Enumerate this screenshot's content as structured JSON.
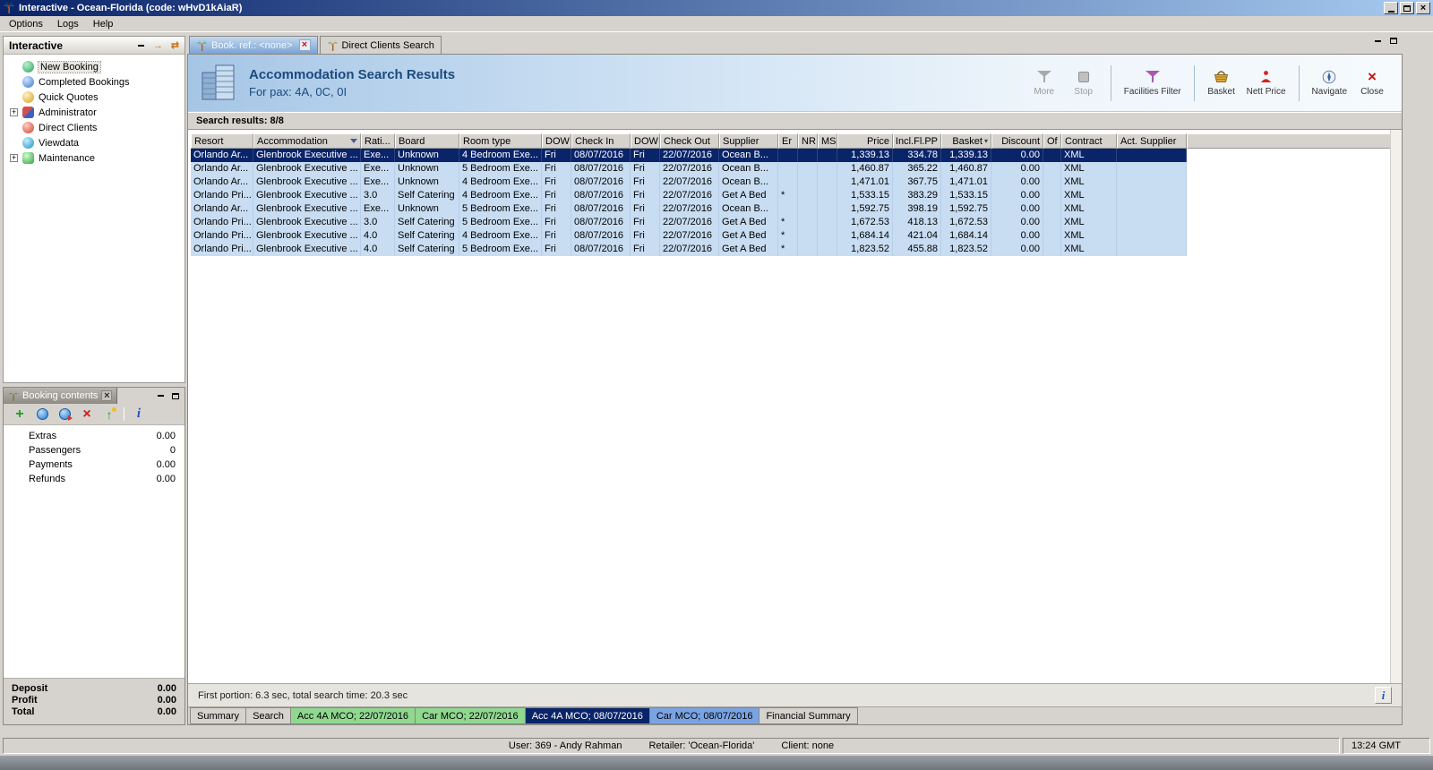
{
  "titlebar": {
    "title": "Interactive - Ocean-Florida (code: wHvD1kAiaR)"
  },
  "menu": {
    "items": [
      "Options",
      "Logs",
      "Help"
    ]
  },
  "sidebar": {
    "title": "Interactive",
    "tree": [
      {
        "label": "New Booking",
        "icon": "new-booking-icon",
        "selected": true
      },
      {
        "label": "Completed Bookings",
        "icon": "completed-bookings-icon"
      },
      {
        "label": "Quick Quotes",
        "icon": "quick-quotes-icon"
      },
      {
        "label": "Administrator",
        "icon": "administrator-icon",
        "expandable": true
      },
      {
        "label": "Direct Clients",
        "icon": "direct-clients-icon"
      },
      {
        "label": "Viewdata",
        "icon": "viewdata-icon"
      },
      {
        "label": "Maintenance",
        "icon": "maintenance-icon",
        "expandable": true
      }
    ]
  },
  "booking_contents": {
    "title": "Booking contents",
    "toolbar_icons": [
      "add-icon",
      "globe-icon",
      "export-globe-icon",
      "delete-icon",
      "promote-icon",
      "separator",
      "info-icon"
    ],
    "rows": [
      [
        "Extras",
        "0.00"
      ],
      [
        "Passengers",
        "0"
      ],
      [
        "Payments",
        "0.00"
      ],
      [
        "Refunds",
        "0.00"
      ]
    ],
    "totals": [
      [
        "Deposit",
        "0.00"
      ],
      [
        "Profit",
        "0.00"
      ],
      [
        "Total",
        "0.00"
      ]
    ]
  },
  "workspace": {
    "tabs": [
      {
        "label": "Book. ref.: <none>",
        "active": true,
        "closable": true
      },
      {
        "label": "Direct Clients Search",
        "active": false
      }
    ],
    "header": {
      "title": "Accommodation Search Results",
      "subtitle": "For pax: 4A, 0C, 0I"
    },
    "toolbar": [
      {
        "label": "More",
        "icon": "more-icon",
        "disabled": true
      },
      {
        "label": "Stop",
        "icon": "stop-icon",
        "disabled": true,
        "sep_after": true
      },
      {
        "label": "Facilities Filter",
        "icon": "facilities-filter-icon",
        "sep_after": true
      },
      {
        "label": "Basket",
        "icon": "basket-icon"
      },
      {
        "label": "Nett Price",
        "icon": "nett-price-icon",
        "sep_after": true
      },
      {
        "label": "Navigate",
        "icon": "navigate-icon"
      },
      {
        "label": "Close",
        "icon": "close-icon"
      }
    ],
    "results_label": "Search results: 8/8",
    "results_table": {
      "columns": [
        {
          "label": "Resort"
        },
        {
          "label": "Accommodation",
          "icon": "filter"
        },
        {
          "label": "Rati..."
        },
        {
          "label": "Board"
        },
        {
          "label": "Room type"
        },
        {
          "label": "DOW"
        },
        {
          "label": "Check In"
        },
        {
          "label": "DOW"
        },
        {
          "label": "Check Out"
        },
        {
          "label": "Supplier"
        },
        {
          "label": "Er"
        },
        {
          "label": "NR"
        },
        {
          "label": "MS"
        },
        {
          "label": "Price",
          "align": "right"
        },
        {
          "label": "Incl.Fl.PP",
          "align": "right"
        },
        {
          "label": "Basket",
          "align": "right",
          "icon": "sort"
        },
        {
          "label": "Discount",
          "align": "right"
        },
        {
          "label": "Of"
        },
        {
          "label": "Contract"
        },
        {
          "label": "Act. Supplier"
        }
      ],
      "selected_row": 0,
      "rows": [
        [
          "Orlando Ar...",
          "Glenbrook Executive ...",
          "Exe...",
          "Unknown",
          "4 Bedroom Exe...",
          "Fri",
          "08/07/2016",
          "Fri",
          "22/07/2016",
          "Ocean B...",
          "",
          "",
          "",
          "1,339.13",
          "334.78",
          "1,339.13",
          "0.00",
          "",
          "XML",
          ""
        ],
        [
          "Orlando Ar...",
          "Glenbrook Executive ...",
          "Exe...",
          "Unknown",
          "5 Bedroom Exe...",
          "Fri",
          "08/07/2016",
          "Fri",
          "22/07/2016",
          "Ocean B...",
          "",
          "",
          "",
          "1,460.87",
          "365.22",
          "1,460.87",
          "0.00",
          "",
          "XML",
          ""
        ],
        [
          "Orlando Ar...",
          "Glenbrook Executive ...",
          "Exe...",
          "Unknown",
          "4 Bedroom Exe...",
          "Fri",
          "08/07/2016",
          "Fri",
          "22/07/2016",
          "Ocean B...",
          "",
          "",
          "",
          "1,471.01",
          "367.75",
          "1,471.01",
          "0.00",
          "",
          "XML",
          ""
        ],
        [
          "Orlando Pri...",
          "Glenbrook Executive ...",
          "3.0",
          "Self Catering",
          "4 Bedroom Exe...",
          "Fri",
          "08/07/2016",
          "Fri",
          "22/07/2016",
          "Get A Bed",
          "*",
          "",
          "",
          "1,533.15",
          "383.29",
          "1,533.15",
          "0.00",
          "",
          "XML",
          ""
        ],
        [
          "Orlando Ar...",
          "Glenbrook Executive ...",
          "Exe...",
          "Unknown",
          "5 Bedroom Exe...",
          "Fri",
          "08/07/2016",
          "Fri",
          "22/07/2016",
          "Ocean B...",
          "",
          "",
          "",
          "1,592.75",
          "398.19",
          "1,592.75",
          "0.00",
          "",
          "XML",
          ""
        ],
        [
          "Orlando Pri...",
          "Glenbrook Executive ...",
          "3.0",
          "Self Catering",
          "5 Bedroom Exe...",
          "Fri",
          "08/07/2016",
          "Fri",
          "22/07/2016",
          "Get A Bed",
          "*",
          "",
          "",
          "1,672.53",
          "418.13",
          "1,672.53",
          "0.00",
          "",
          "XML",
          ""
        ],
        [
          "Orlando Pri...",
          "Glenbrook Executive ...",
          "4.0",
          "Self Catering",
          "4 Bedroom Exe...",
          "Fri",
          "08/07/2016",
          "Fri",
          "22/07/2016",
          "Get A Bed",
          "*",
          "",
          "",
          "1,684.14",
          "421.04",
          "1,684.14",
          "0.00",
          "",
          "XML",
          ""
        ],
        [
          "Orlando Pri...",
          "Glenbrook Executive ...",
          "4.0",
          "Self Catering",
          "5 Bedroom Exe...",
          "Fri",
          "08/07/2016",
          "Fri",
          "22/07/2016",
          "Get A Bed",
          "*",
          "",
          "",
          "1,823.52",
          "455.88",
          "1,823.52",
          "0.00",
          "",
          "XML",
          ""
        ]
      ]
    },
    "status_text": "First portion: 6.3 sec, total search time: 20.3 sec",
    "bottom_tabs": [
      {
        "label": "Summary",
        "style": "plain"
      },
      {
        "label": "Search",
        "style": "plain"
      },
      {
        "label": "Acc 4A MCO; 22/07/2016",
        "style": "green"
      },
      {
        "label": "Car MCO; 22/07/2016",
        "style": "green"
      },
      {
        "label": "Acc 4A MCO; 08/07/2016",
        "style": "navy",
        "selected": true
      },
      {
        "label": "Car MCO; 08/07/2016",
        "style": "blue"
      },
      {
        "label": "Financial Summary",
        "style": "plain"
      }
    ]
  },
  "statusbar": {
    "user": "User: 369 - Andy Rahman",
    "retailer": "Retailer: 'Ocean-Florida'",
    "client": "Client: none",
    "time": "13:24 GMT"
  }
}
